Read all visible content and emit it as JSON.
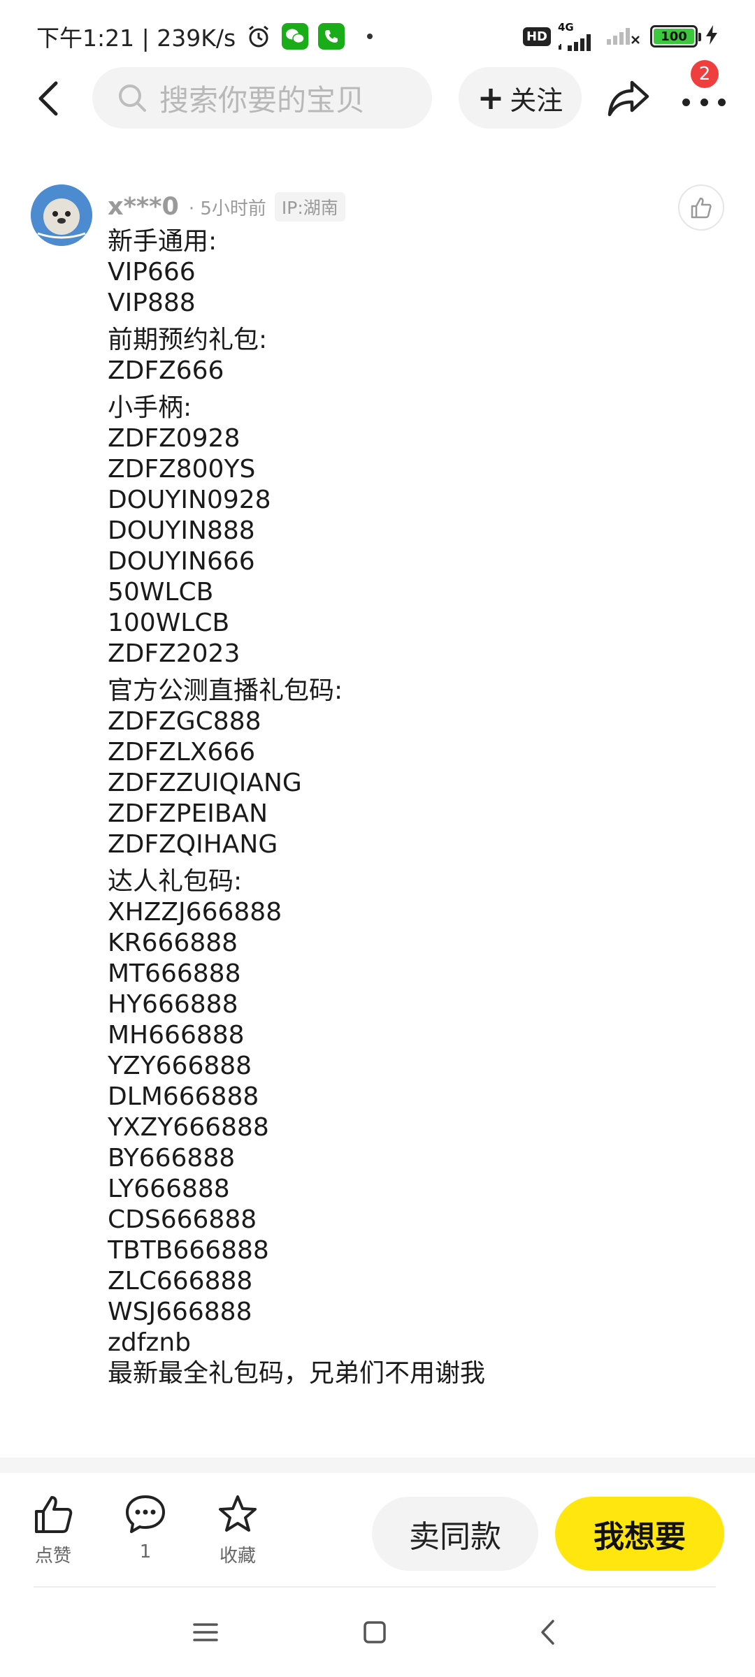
{
  "status_bar": {
    "time": "下午1:21",
    "speed": "239K/s",
    "hd": "HD",
    "network": "4G",
    "battery": "100"
  },
  "header": {
    "search_placeholder": "搜索你要的宝贝",
    "follow_label": "关注",
    "notification_count": "2"
  },
  "comment": {
    "username": "x***0",
    "time": "· 5小时前",
    "ip": "IP:湖南",
    "lines": [
      {
        "text": "新手通用:",
        "heading": true
      },
      {
        "text": "VIP666",
        "heading": false
      },
      {
        "text": "VIP888",
        "heading": false
      },
      {
        "text": "前期预约礼包:",
        "heading": true
      },
      {
        "text": "ZDFZ666",
        "heading": false
      },
      {
        "text": "小手柄:",
        "heading": true
      },
      {
        "text": "ZDFZ0928",
        "heading": false
      },
      {
        "text": "ZDFZ800YS",
        "heading": false
      },
      {
        "text": "DOUYIN0928",
        "heading": false
      },
      {
        "text": "DOUYIN888",
        "heading": false
      },
      {
        "text": "DOUYIN666",
        "heading": false
      },
      {
        "text": "50WLCB",
        "heading": false
      },
      {
        "text": "100WLCB",
        "heading": false
      },
      {
        "text": "ZDFZ2023",
        "heading": false
      },
      {
        "text": "官方公测直播礼包码:",
        "heading": true
      },
      {
        "text": "ZDFZGC888",
        "heading": false
      },
      {
        "text": "ZDFZLX666",
        "heading": false
      },
      {
        "text": "ZDFZZUIQIANG",
        "heading": false
      },
      {
        "text": "ZDFZPEIBAN",
        "heading": false
      },
      {
        "text": "ZDFZQIHANG",
        "heading": false
      },
      {
        "text": "达人礼包码:",
        "heading": true
      },
      {
        "text": "XHZZJ666888",
        "heading": false
      },
      {
        "text": "KR666888",
        "heading": false
      },
      {
        "text": "MT666888",
        "heading": false
      },
      {
        "text": "HY666888",
        "heading": false
      },
      {
        "text": "MH666888",
        "heading": false
      },
      {
        "text": "YZY666888",
        "heading": false
      },
      {
        "text": "DLM666888",
        "heading": false
      },
      {
        "text": "YXZY666888",
        "heading": false
      },
      {
        "text": "BY666888",
        "heading": false
      },
      {
        "text": "LY666888",
        "heading": false
      },
      {
        "text": "CDS666888",
        "heading": false
      },
      {
        "text": "TBTB666888",
        "heading": false
      },
      {
        "text": "ZLC666888",
        "heading": false
      },
      {
        "text": "WSJ666888",
        "heading": false
      },
      {
        "text": "zdfznb",
        "heading": false
      },
      {
        "text": "最新最全礼包码，兄弟们不用谢我",
        "heading": false
      }
    ]
  },
  "actions": {
    "like_label": "点赞",
    "comment_count": "1",
    "favorite_label": "收藏",
    "sell_same_label": "卖同款",
    "want_label": "我想要"
  }
}
